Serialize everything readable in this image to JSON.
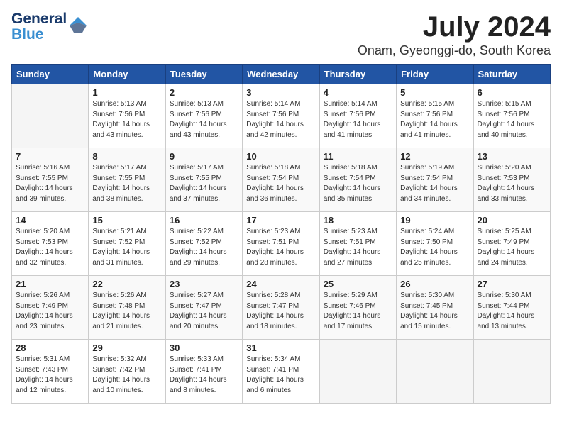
{
  "logo": {
    "line1": "General",
    "line2": "Blue"
  },
  "title": "July 2024",
  "location": "Onam, Gyeonggi-do, South Korea",
  "weekdays": [
    "Sunday",
    "Monday",
    "Tuesday",
    "Wednesday",
    "Thursday",
    "Friday",
    "Saturday"
  ],
  "weeks": [
    [
      {
        "day": "",
        "sunrise": "",
        "sunset": "",
        "daylight": ""
      },
      {
        "day": "1",
        "sunrise": "Sunrise: 5:13 AM",
        "sunset": "Sunset: 7:56 PM",
        "daylight": "Daylight: 14 hours and 43 minutes."
      },
      {
        "day": "2",
        "sunrise": "Sunrise: 5:13 AM",
        "sunset": "Sunset: 7:56 PM",
        "daylight": "Daylight: 14 hours and 43 minutes."
      },
      {
        "day": "3",
        "sunrise": "Sunrise: 5:14 AM",
        "sunset": "Sunset: 7:56 PM",
        "daylight": "Daylight: 14 hours and 42 minutes."
      },
      {
        "day": "4",
        "sunrise": "Sunrise: 5:14 AM",
        "sunset": "Sunset: 7:56 PM",
        "daylight": "Daylight: 14 hours and 41 minutes."
      },
      {
        "day": "5",
        "sunrise": "Sunrise: 5:15 AM",
        "sunset": "Sunset: 7:56 PM",
        "daylight": "Daylight: 14 hours and 41 minutes."
      },
      {
        "day": "6",
        "sunrise": "Sunrise: 5:15 AM",
        "sunset": "Sunset: 7:56 PM",
        "daylight": "Daylight: 14 hours and 40 minutes."
      }
    ],
    [
      {
        "day": "7",
        "sunrise": "Sunrise: 5:16 AM",
        "sunset": "Sunset: 7:55 PM",
        "daylight": "Daylight: 14 hours and 39 minutes."
      },
      {
        "day": "8",
        "sunrise": "Sunrise: 5:17 AM",
        "sunset": "Sunset: 7:55 PM",
        "daylight": "Daylight: 14 hours and 38 minutes."
      },
      {
        "day": "9",
        "sunrise": "Sunrise: 5:17 AM",
        "sunset": "Sunset: 7:55 PM",
        "daylight": "Daylight: 14 hours and 37 minutes."
      },
      {
        "day": "10",
        "sunrise": "Sunrise: 5:18 AM",
        "sunset": "Sunset: 7:54 PM",
        "daylight": "Daylight: 14 hours and 36 minutes."
      },
      {
        "day": "11",
        "sunrise": "Sunrise: 5:18 AM",
        "sunset": "Sunset: 7:54 PM",
        "daylight": "Daylight: 14 hours and 35 minutes."
      },
      {
        "day": "12",
        "sunrise": "Sunrise: 5:19 AM",
        "sunset": "Sunset: 7:54 PM",
        "daylight": "Daylight: 14 hours and 34 minutes."
      },
      {
        "day": "13",
        "sunrise": "Sunrise: 5:20 AM",
        "sunset": "Sunset: 7:53 PM",
        "daylight": "Daylight: 14 hours and 33 minutes."
      }
    ],
    [
      {
        "day": "14",
        "sunrise": "Sunrise: 5:20 AM",
        "sunset": "Sunset: 7:53 PM",
        "daylight": "Daylight: 14 hours and 32 minutes."
      },
      {
        "day": "15",
        "sunrise": "Sunrise: 5:21 AM",
        "sunset": "Sunset: 7:52 PM",
        "daylight": "Daylight: 14 hours and 31 minutes."
      },
      {
        "day": "16",
        "sunrise": "Sunrise: 5:22 AM",
        "sunset": "Sunset: 7:52 PM",
        "daylight": "Daylight: 14 hours and 29 minutes."
      },
      {
        "day": "17",
        "sunrise": "Sunrise: 5:23 AM",
        "sunset": "Sunset: 7:51 PM",
        "daylight": "Daylight: 14 hours and 28 minutes."
      },
      {
        "day": "18",
        "sunrise": "Sunrise: 5:23 AM",
        "sunset": "Sunset: 7:51 PM",
        "daylight": "Daylight: 14 hours and 27 minutes."
      },
      {
        "day": "19",
        "sunrise": "Sunrise: 5:24 AM",
        "sunset": "Sunset: 7:50 PM",
        "daylight": "Daylight: 14 hours and 25 minutes."
      },
      {
        "day": "20",
        "sunrise": "Sunrise: 5:25 AM",
        "sunset": "Sunset: 7:49 PM",
        "daylight": "Daylight: 14 hours and 24 minutes."
      }
    ],
    [
      {
        "day": "21",
        "sunrise": "Sunrise: 5:26 AM",
        "sunset": "Sunset: 7:49 PM",
        "daylight": "Daylight: 14 hours and 23 minutes."
      },
      {
        "day": "22",
        "sunrise": "Sunrise: 5:26 AM",
        "sunset": "Sunset: 7:48 PM",
        "daylight": "Daylight: 14 hours and 21 minutes."
      },
      {
        "day": "23",
        "sunrise": "Sunrise: 5:27 AM",
        "sunset": "Sunset: 7:47 PM",
        "daylight": "Daylight: 14 hours and 20 minutes."
      },
      {
        "day": "24",
        "sunrise": "Sunrise: 5:28 AM",
        "sunset": "Sunset: 7:47 PM",
        "daylight": "Daylight: 14 hours and 18 minutes."
      },
      {
        "day": "25",
        "sunrise": "Sunrise: 5:29 AM",
        "sunset": "Sunset: 7:46 PM",
        "daylight": "Daylight: 14 hours and 17 minutes."
      },
      {
        "day": "26",
        "sunrise": "Sunrise: 5:30 AM",
        "sunset": "Sunset: 7:45 PM",
        "daylight": "Daylight: 14 hours and 15 minutes."
      },
      {
        "day": "27",
        "sunrise": "Sunrise: 5:30 AM",
        "sunset": "Sunset: 7:44 PM",
        "daylight": "Daylight: 14 hours and 13 minutes."
      }
    ],
    [
      {
        "day": "28",
        "sunrise": "Sunrise: 5:31 AM",
        "sunset": "Sunset: 7:43 PM",
        "daylight": "Daylight: 14 hours and 12 minutes."
      },
      {
        "day": "29",
        "sunrise": "Sunrise: 5:32 AM",
        "sunset": "Sunset: 7:42 PM",
        "daylight": "Daylight: 14 hours and 10 minutes."
      },
      {
        "day": "30",
        "sunrise": "Sunrise: 5:33 AM",
        "sunset": "Sunset: 7:41 PM",
        "daylight": "Daylight: 14 hours and 8 minutes."
      },
      {
        "day": "31",
        "sunrise": "Sunrise: 5:34 AM",
        "sunset": "Sunset: 7:41 PM",
        "daylight": "Daylight: 14 hours and 6 minutes."
      },
      {
        "day": "",
        "sunrise": "",
        "sunset": "",
        "daylight": ""
      },
      {
        "day": "",
        "sunrise": "",
        "sunset": "",
        "daylight": ""
      },
      {
        "day": "",
        "sunrise": "",
        "sunset": "",
        "daylight": ""
      }
    ]
  ]
}
